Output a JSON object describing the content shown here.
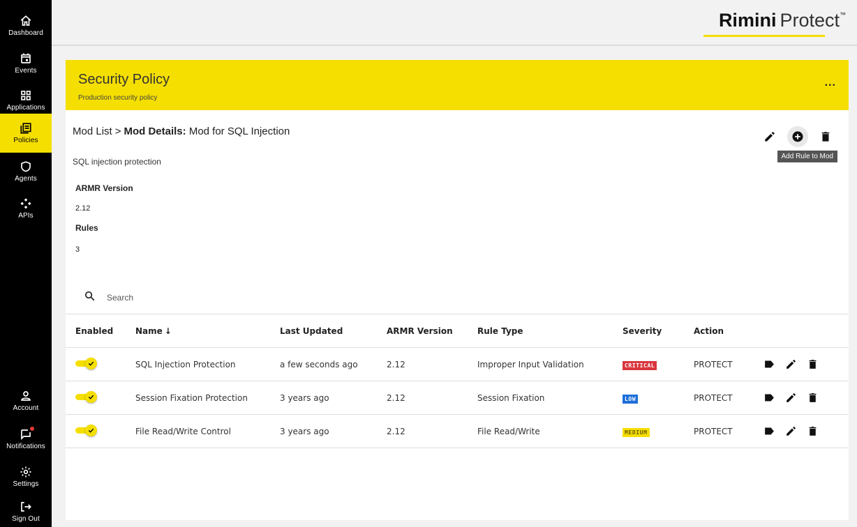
{
  "nav": {
    "dashboard": "Dashboard",
    "events": "Events",
    "applications": "Applications",
    "policies": "Policies",
    "agents": "Agents",
    "apis": "APIs",
    "account": "Account",
    "notifications": "Notifications",
    "settings": "Settings",
    "signout": "Sign Out"
  },
  "brand": {
    "bold": "Rimini",
    "thin": "Protect",
    "tm": "™"
  },
  "banner": {
    "title": "Security Policy",
    "subtitle": "Production security policy",
    "more": "..."
  },
  "breadcrumb": {
    "parent": "Mod List",
    "separator": ">",
    "current_label": "Mod Details:",
    "current_value": " Mod for SQL Injection"
  },
  "mod": {
    "description": "SQL injection protection",
    "armr_version_label": "ARMR Version",
    "armr_version": "2.12",
    "rules_label": "Rules",
    "rules": "3"
  },
  "tooltip": "Add Rule to Mod",
  "search": {
    "placeholder": "Search"
  },
  "table": {
    "headers": {
      "enabled": "Enabled",
      "name": "Name",
      "last_updated": "Last Updated",
      "armr_version": "ARMR Version",
      "rule_type": "Rule Type",
      "severity": "Severity",
      "action": "Action"
    },
    "sort_indicator": "↓",
    "rows": [
      {
        "name": "SQL Injection Protection",
        "last_updated": "a few seconds ago",
        "armr_version": "2.12",
        "rule_type": "Improper Input Validation",
        "severity": "CRITICAL",
        "action": "PROTECT"
      },
      {
        "name": "Session Fixation Protection",
        "last_updated": "3 years ago",
        "armr_version": "2.12",
        "rule_type": "Session Fixation",
        "severity": "LOW",
        "action": "PROTECT"
      },
      {
        "name": "File Read/Write Control",
        "last_updated": "3 years ago",
        "armr_version": "2.12",
        "rule_type": "File Read/Write",
        "severity": "MEDIUM",
        "action": "PROTECT"
      }
    ]
  },
  "colors": {
    "accent": "#f5df00",
    "sidebar_bg": "#000000",
    "critical_bg": "#d9363e",
    "low_bg": "#1e6fd9",
    "medium_bg": "#f5df00"
  }
}
